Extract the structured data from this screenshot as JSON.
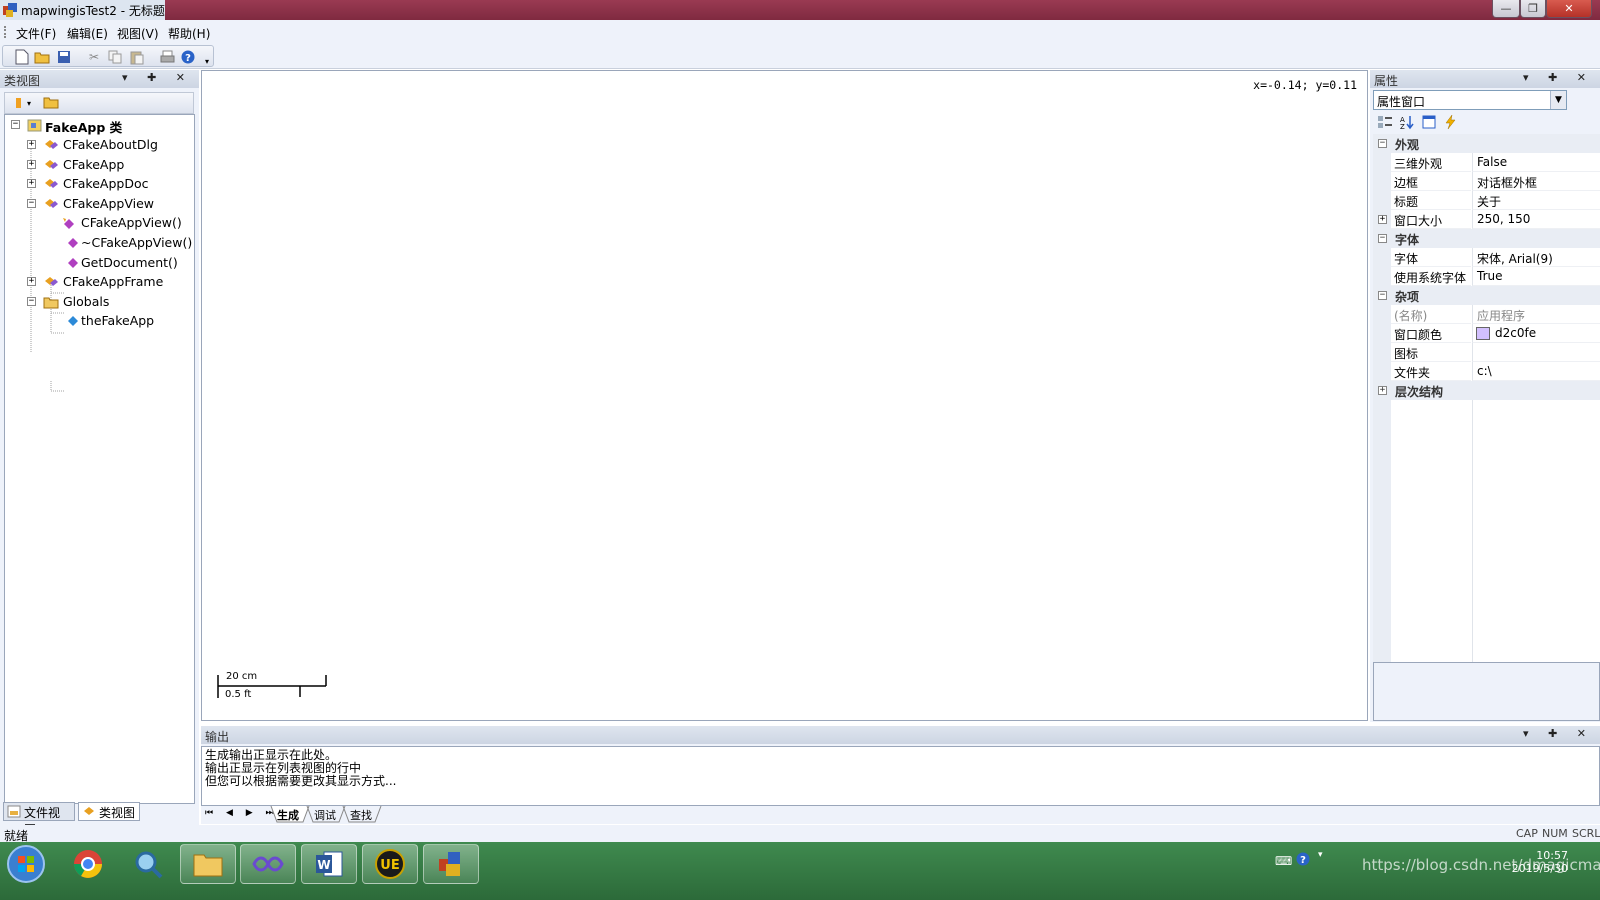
{
  "window": {
    "title": "mapwingisTest2 - 无标题",
    "controls": {
      "minimize": "—",
      "maximize": "❐",
      "close": "✕"
    }
  },
  "menu": [
    "文件(F)",
    "编辑(E)",
    "视图(V)",
    "帮助(H)"
  ],
  "toolbar": {
    "buttons": [
      "new-icon",
      "open-icon",
      "save-icon",
      "cut-icon",
      "copy-icon",
      "paste-icon",
      "print-icon",
      "help-icon"
    ]
  },
  "classview": {
    "title": "类视图",
    "panel_buttons": "▾ ✚ ✕",
    "tree": [
      {
        "label": "FakeApp 类",
        "bold": true,
        "expander": "−"
      },
      {
        "label": "CFakeAboutDlg",
        "expander": "+"
      },
      {
        "label": "CFakeApp",
        "expander": "+"
      },
      {
        "label": "CFakeAppDoc",
        "expander": "+"
      },
      {
        "label": "CFakeAppView",
        "expander": "−"
      },
      {
        "label": "CFakeAppView()"
      },
      {
        "label": "~CFakeAppView()"
      },
      {
        "label": "GetDocument()"
      },
      {
        "label": "CFakeAppFrame",
        "expander": "+"
      },
      {
        "label": "Globals",
        "expander": "−"
      },
      {
        "label": "theFakeApp"
      }
    ],
    "tabs": [
      "文件视图",
      "类视图"
    ]
  },
  "document": {
    "coords": "x=-0.14; y=0.11",
    "scale_top": "20 cm",
    "scale_bottom": "0.5 ft"
  },
  "properties": {
    "title": "属性",
    "panel_buttons": "▾ ✚ ✕",
    "combo_value": "属性窗口",
    "rows": [
      {
        "type": "cat",
        "name": "外观",
        "expander": "−"
      },
      {
        "name": "三维外观",
        "value": "False"
      },
      {
        "name": "边框",
        "value": "对话框外框"
      },
      {
        "name": "标题",
        "value": "关于"
      },
      {
        "name": "窗口大小",
        "value": "250, 150",
        "expander": "+"
      },
      {
        "type": "cat",
        "name": "字体",
        "expander": "−"
      },
      {
        "name": "字体",
        "value": "宋体, Arial(9)"
      },
      {
        "name": "使用系统字体",
        "value": "True"
      },
      {
        "type": "cat",
        "name": "杂项",
        "expander": "−"
      },
      {
        "name": "(名称)",
        "value": "应用程序",
        "disabled": true
      },
      {
        "name": "窗口颜色",
        "value": "d2c0fe",
        "swatch": "#d2c0fe"
      },
      {
        "name": "图标",
        "value": ""
      },
      {
        "name": "文件夹",
        "value": "c:\\"
      },
      {
        "type": "cat",
        "name": "层次结构",
        "expander": "+"
      }
    ]
  },
  "output": {
    "title": "输出",
    "panel_buttons": "▾ ✚ ✕",
    "lines": [
      "生成输出正显示在此处。",
      "输出正显示在列表视图的行中",
      "但您可以根据需要更改其显示方式..."
    ],
    "nav": "⏮ ◀ ▶ ⏭",
    "tabs": [
      "生成",
      "调试",
      "查找"
    ]
  },
  "status": {
    "text": "就绪",
    "indicators": [
      "CAP",
      "NUM",
      "SCRL"
    ]
  },
  "taskbar": {
    "apps": [
      "start-orb",
      "chrome",
      "search-magnifier",
      "file-explorer",
      "visual-studio",
      "word",
      "ultraedit",
      "mfc-app"
    ],
    "clock_time": "10:57",
    "clock_date": "2019/5/30",
    "watermark": "https://blog.csdn.net/dmagicmail"
  },
  "colors": {
    "title_bar": "#8b3048",
    "panel_bg": "#eef2fa",
    "taskbar": "#2f7040",
    "window_color_swatch": "#d2c0fe"
  }
}
